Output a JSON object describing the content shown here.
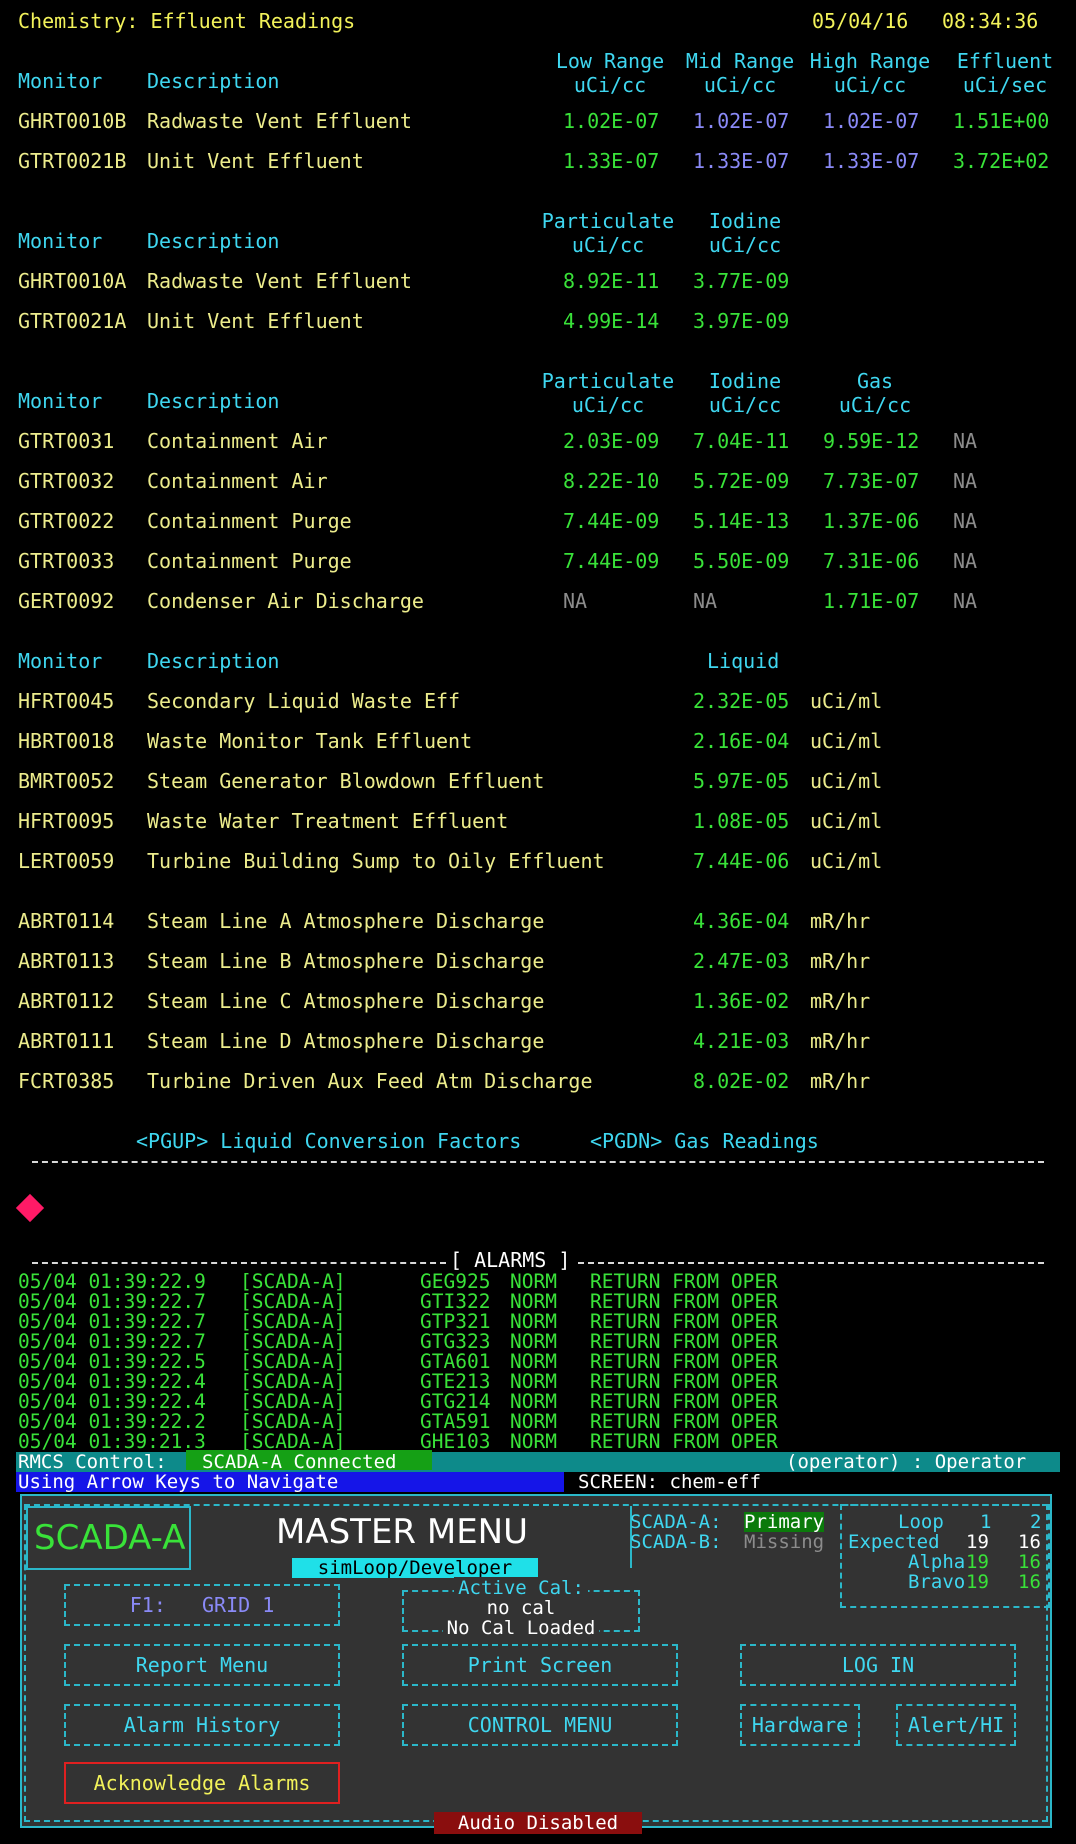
{
  "header": {
    "title": "Chemistry: Effluent Readings",
    "date": "05/04/16",
    "time": "08:34:36"
  },
  "section1": {
    "col_monitor": "Monitor",
    "col_desc": "Description",
    "cols": [
      {
        "l1": "Low Range",
        "l2": "uCi/cc"
      },
      {
        "l1": "Mid Range",
        "l2": "uCi/cc"
      },
      {
        "l1": "High Range",
        "l2": "uCi/cc"
      },
      {
        "l1": "Effluent",
        "l2": "uCi/sec"
      }
    ],
    "rows": [
      {
        "id": "GHRT0010B",
        "desc": "Radwaste Vent Effluent",
        "v": [
          "1.02E-07",
          "1.02E-07",
          "1.02E-07",
          "1.51E+00"
        ]
      },
      {
        "id": "GTRT0021B",
        "desc": "Unit Vent Effluent",
        "v": [
          "1.33E-07",
          "1.33E-07",
          "1.33E-07",
          "3.72E+02"
        ]
      }
    ]
  },
  "section2": {
    "col_monitor": "Monitor",
    "col_desc": "Description",
    "cols": [
      {
        "l1": "Particulate",
        "l2": "uCi/cc"
      },
      {
        "l1": "Iodine",
        "l2": "uCi/cc"
      }
    ],
    "rows": [
      {
        "id": "GHRT0010A",
        "desc": "Radwaste Vent Effluent",
        "v": [
          "8.92E-11",
          "3.77E-09"
        ]
      },
      {
        "id": "GTRT0021A",
        "desc": "Unit Vent Effluent",
        "v": [
          "4.99E-14",
          "3.97E-09"
        ]
      }
    ]
  },
  "section3": {
    "col_monitor": "Monitor",
    "col_desc": "Description",
    "cols": [
      {
        "l1": "Particulate",
        "l2": "uCi/cc"
      },
      {
        "l1": "Iodine",
        "l2": "uCi/cc"
      },
      {
        "l1": "Gas",
        "l2": "uCi/cc"
      }
    ],
    "rows": [
      {
        "id": "GTRT0031",
        "desc": "Containment Air",
        "v": [
          "2.03E-09",
          "7.04E-11",
          "9.59E-12",
          "NA"
        ]
      },
      {
        "id": "GTRT0032",
        "desc": "Containment Air",
        "v": [
          "8.22E-10",
          "5.72E-09",
          "7.73E-07",
          "NA"
        ]
      },
      {
        "id": "GTRT0022",
        "desc": "Containment Purge",
        "v": [
          "7.44E-09",
          "5.14E-13",
          "1.37E-06",
          "NA"
        ]
      },
      {
        "id": "GTRT0033",
        "desc": "Containment Purge",
        "v": [
          "7.44E-09",
          "5.50E-09",
          "7.31E-06",
          "NA"
        ]
      },
      {
        "id": "GERT0092",
        "desc": "Condenser Air Discharge",
        "v": [
          "NA",
          "NA",
          "1.71E-07",
          "NA"
        ]
      }
    ]
  },
  "section4": {
    "col_monitor": "Monitor",
    "col_desc": "Description",
    "col_liquid": "Liquid",
    "rows": [
      {
        "id": "HFRT0045",
        "desc": "Secondary Liquid Waste Eff",
        "v": "2.32E-05",
        "u": "uCi/ml"
      },
      {
        "id": "HBRT0018",
        "desc": "Waste Monitor Tank Effluent",
        "v": "2.16E-04",
        "u": "uCi/ml"
      },
      {
        "id": "BMRT0052",
        "desc": "Steam Generator Blowdown Effluent",
        "v": "5.97E-05",
        "u": "uCi/ml"
      },
      {
        "id": "HFRT0095",
        "desc": "Waste Water Treatment Effluent",
        "v": "1.08E-05",
        "u": "uCi/ml"
      },
      {
        "id": "LERT0059",
        "desc": "Turbine Building Sump to Oily Effluent",
        "v": "7.44E-06",
        "u": "uCi/ml"
      }
    ]
  },
  "section5": {
    "rows": [
      {
        "id": "ABRT0114",
        "desc": "Steam Line A Atmosphere Discharge",
        "v": "4.36E-04",
        "u": "mR/hr"
      },
      {
        "id": "ABRT0113",
        "desc": "Steam Line B Atmosphere Discharge",
        "v": "2.47E-03",
        "u": "mR/hr"
      },
      {
        "id": "ABRT0112",
        "desc": "Steam Line C Atmosphere Discharge",
        "v": "1.36E-02",
        "u": "mR/hr"
      },
      {
        "id": "ABRT0111",
        "desc": "Steam Line D Atmosphere Discharge",
        "v": "4.21E-03",
        "u": "mR/hr"
      },
      {
        "id": "FCRT0385",
        "desc": "Turbine Driven Aux Feed Atm Discharge",
        "v": "8.02E-02",
        "u": "mR/hr"
      }
    ]
  },
  "nav": {
    "pgup": "<PGUP> Liquid Conversion Factors",
    "pgdn": "<PGDN> Gas Readings"
  },
  "alarms": {
    "title": "[ ALARMS ]",
    "rows": [
      {
        "ts": "05/04 01:39:22.9",
        "src": "[SCADA-A]",
        "tag": "GEG925",
        "state": "NORM",
        "msg": "RETURN FROM OPER"
      },
      {
        "ts": "05/04 01:39:22.7",
        "src": "[SCADA-A]",
        "tag": "GTI322",
        "state": "NORM",
        "msg": "RETURN FROM OPER"
      },
      {
        "ts": "05/04 01:39:22.7",
        "src": "[SCADA-A]",
        "tag": "GTP321",
        "state": "NORM",
        "msg": "RETURN FROM OPER"
      },
      {
        "ts": "05/04 01:39:22.7",
        "src": "[SCADA-A]",
        "tag": "GTG323",
        "state": "NORM",
        "msg": "RETURN FROM OPER"
      },
      {
        "ts": "05/04 01:39:22.5",
        "src": "[SCADA-A]",
        "tag": "GTA601",
        "state": "NORM",
        "msg": "RETURN FROM OPER"
      },
      {
        "ts": "05/04 01:39:22.4",
        "src": "[SCADA-A]",
        "tag": "GTE213",
        "state": "NORM",
        "msg": "RETURN FROM OPER"
      },
      {
        "ts": "05/04 01:39:22.4",
        "src": "[SCADA-A]",
        "tag": "GTG214",
        "state": "NORM",
        "msg": "RETURN FROM OPER"
      },
      {
        "ts": "05/04 01:39:22.2",
        "src": "[SCADA-A]",
        "tag": "GTA591",
        "state": "NORM",
        "msg": "RETURN FROM OPER"
      },
      {
        "ts": "05/04 01:39:21.3",
        "src": "[SCADA-A]",
        "tag": "GHE103",
        "state": "NORM",
        "msg": "RETURN FROM OPER"
      }
    ]
  },
  "status": {
    "rmcs_label": "RMCS Control:",
    "rmcs_value": "SCADA-A Connected",
    "user": "(operator) : Operator",
    "hint": "Using Arrow Keys to Navigate",
    "screen": "SCREEN: chem-eff"
  },
  "menu": {
    "brand": "SCADA-A",
    "title": "MASTER MENU",
    "subtitle": "simLoop/Developer",
    "scada_a_label": "SCADA-A:",
    "scada_a_value": "Primary",
    "scada_b_label": "SCADA-B:",
    "scada_b_value": "Missing",
    "loop_label": "Loop",
    "loop_1": "1",
    "loop_2": "2",
    "expected_label": "Expected",
    "expected_1": "19",
    "expected_2": "16",
    "alpha_label": "Alpha",
    "alpha_1": "19",
    "alpha_2": "16",
    "bravo_label": "Bravo",
    "bravo_1": "19",
    "bravo_2": "16",
    "f1_key": "F1:",
    "f1_label": "GRID 1",
    "active_cal_label": "Active Cal:",
    "active_cal_value": "no cal",
    "cal_loaded": "No Cal Loaded",
    "report_menu": "Report  Menu",
    "print_screen": "Print Screen",
    "log_in": "LOG IN",
    "alarm_history": "Alarm  History",
    "control_menu": "CONTROL MENU",
    "hardware": "Hardware",
    "alert_hi": "Alert/HI",
    "ack_alarms": "Acknowledge Alarms",
    "audio": "Audio Disabled"
  },
  "colors": {
    "accent": "#3fd7f0",
    "ok": "#39e239",
    "warn": "#f2f25a",
    "alarm_marker": "#ff1a66"
  }
}
